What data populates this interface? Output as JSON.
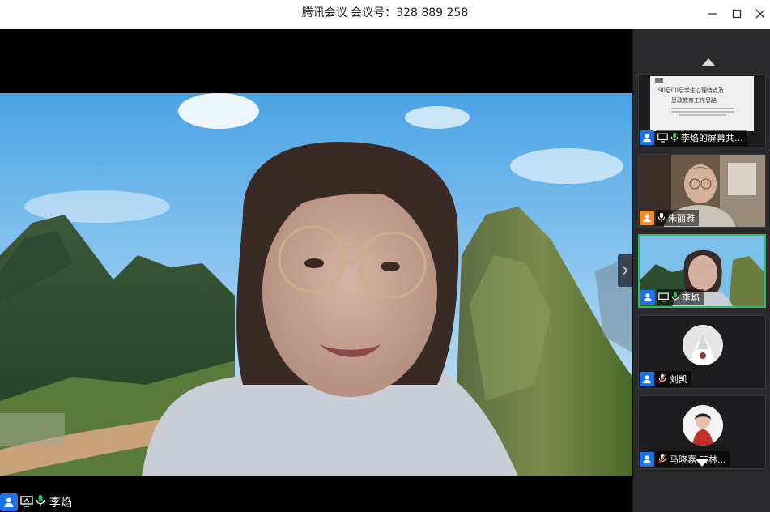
{
  "window": {
    "title": "腾讯会议 会议号：328 889 258",
    "minimize_icon": "minimize-icon",
    "maximize_icon": "maximize-icon",
    "close_icon": "close-icon"
  },
  "main_video": {
    "speaker_name": "李焰",
    "icons": [
      "person-icon",
      "screen-share-icon",
      "mic-icon"
    ]
  },
  "participants": [
    {
      "name": "李焰的屏幕共...",
      "type": "screen-share",
      "slide_lines": [
        "90后00后学生心理特点及",
        "思政教育工作思路"
      ],
      "badge_color": "#1a73e8",
      "mic": "on"
    },
    {
      "name": "朱丽雅",
      "type": "video",
      "badge_color": "#f08a24",
      "mic": "on"
    },
    {
      "name": "李焰",
      "type": "video",
      "badge_color": "#1a73e8",
      "mic": "on",
      "active": true
    },
    {
      "name": "刘凯",
      "type": "avatar",
      "badge_color": "#1a73e8",
      "mic": "muted"
    },
    {
      "name": "马晓嘉-吉林...",
      "type": "avatar",
      "badge_color": "#1a73e8",
      "mic": "muted"
    }
  ],
  "colors": {
    "active_border": "#22c06a",
    "badge_blue": "#1a73e8",
    "badge_orange": "#f08a24",
    "sidebar_bg": "#2a2a2c"
  }
}
